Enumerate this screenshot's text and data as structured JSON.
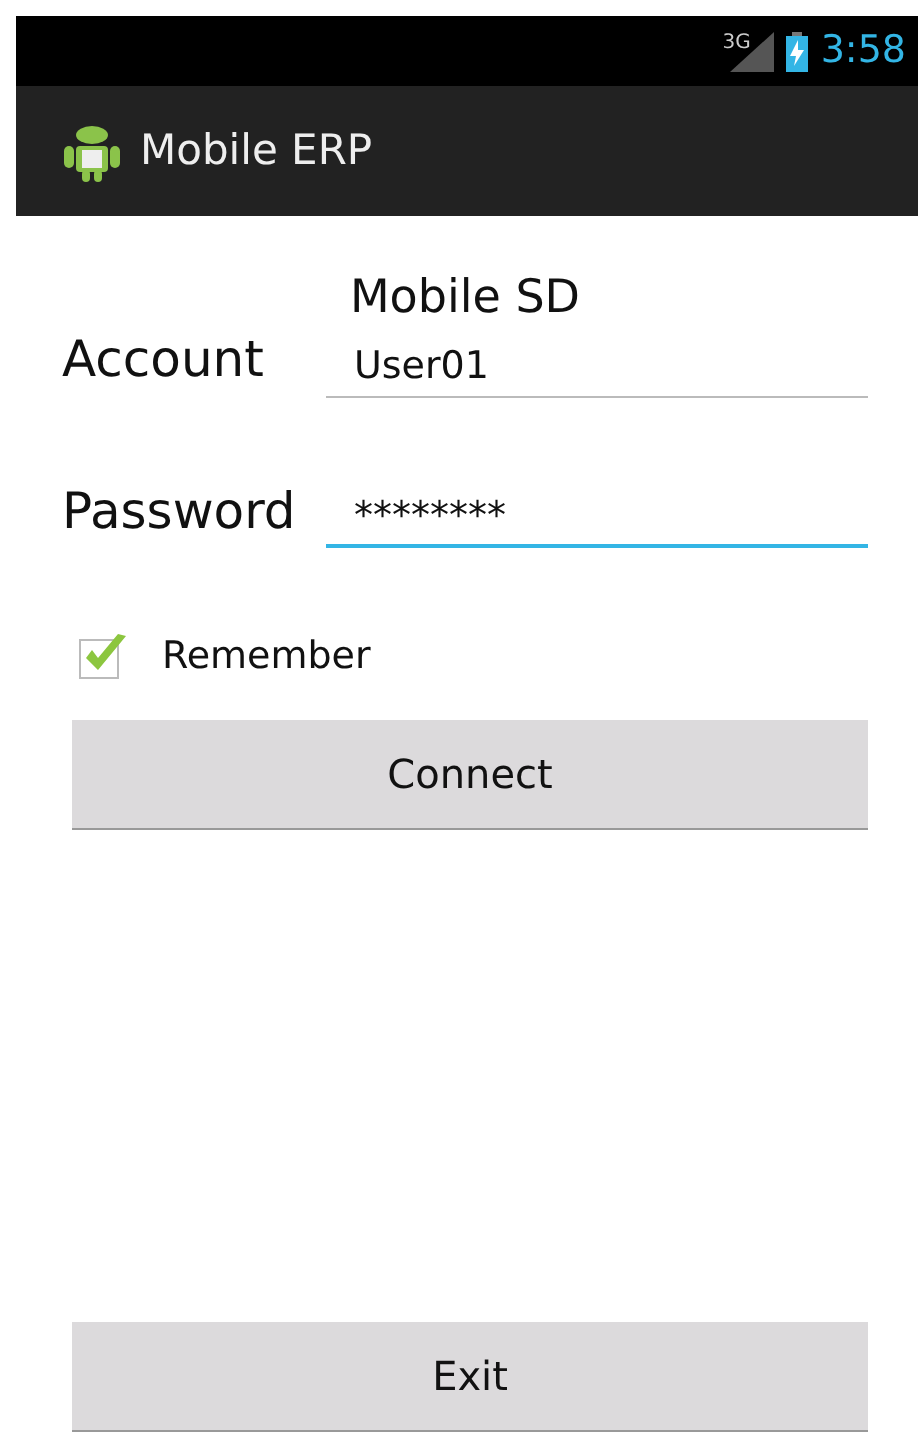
{
  "status_bar": {
    "network": "3G",
    "time": "3:58"
  },
  "action_bar": {
    "title": "Mobile ERP"
  },
  "form": {
    "heading": "Mobile SD",
    "fields": [
      {
        "label": "Account",
        "value": "User01",
        "focused": false
      },
      {
        "label": "Password",
        "value": "********",
        "focused": true
      }
    ],
    "remember": {
      "label": "Remember",
      "checked": true
    },
    "connect": "Connect"
  },
  "exit": "Exit"
}
